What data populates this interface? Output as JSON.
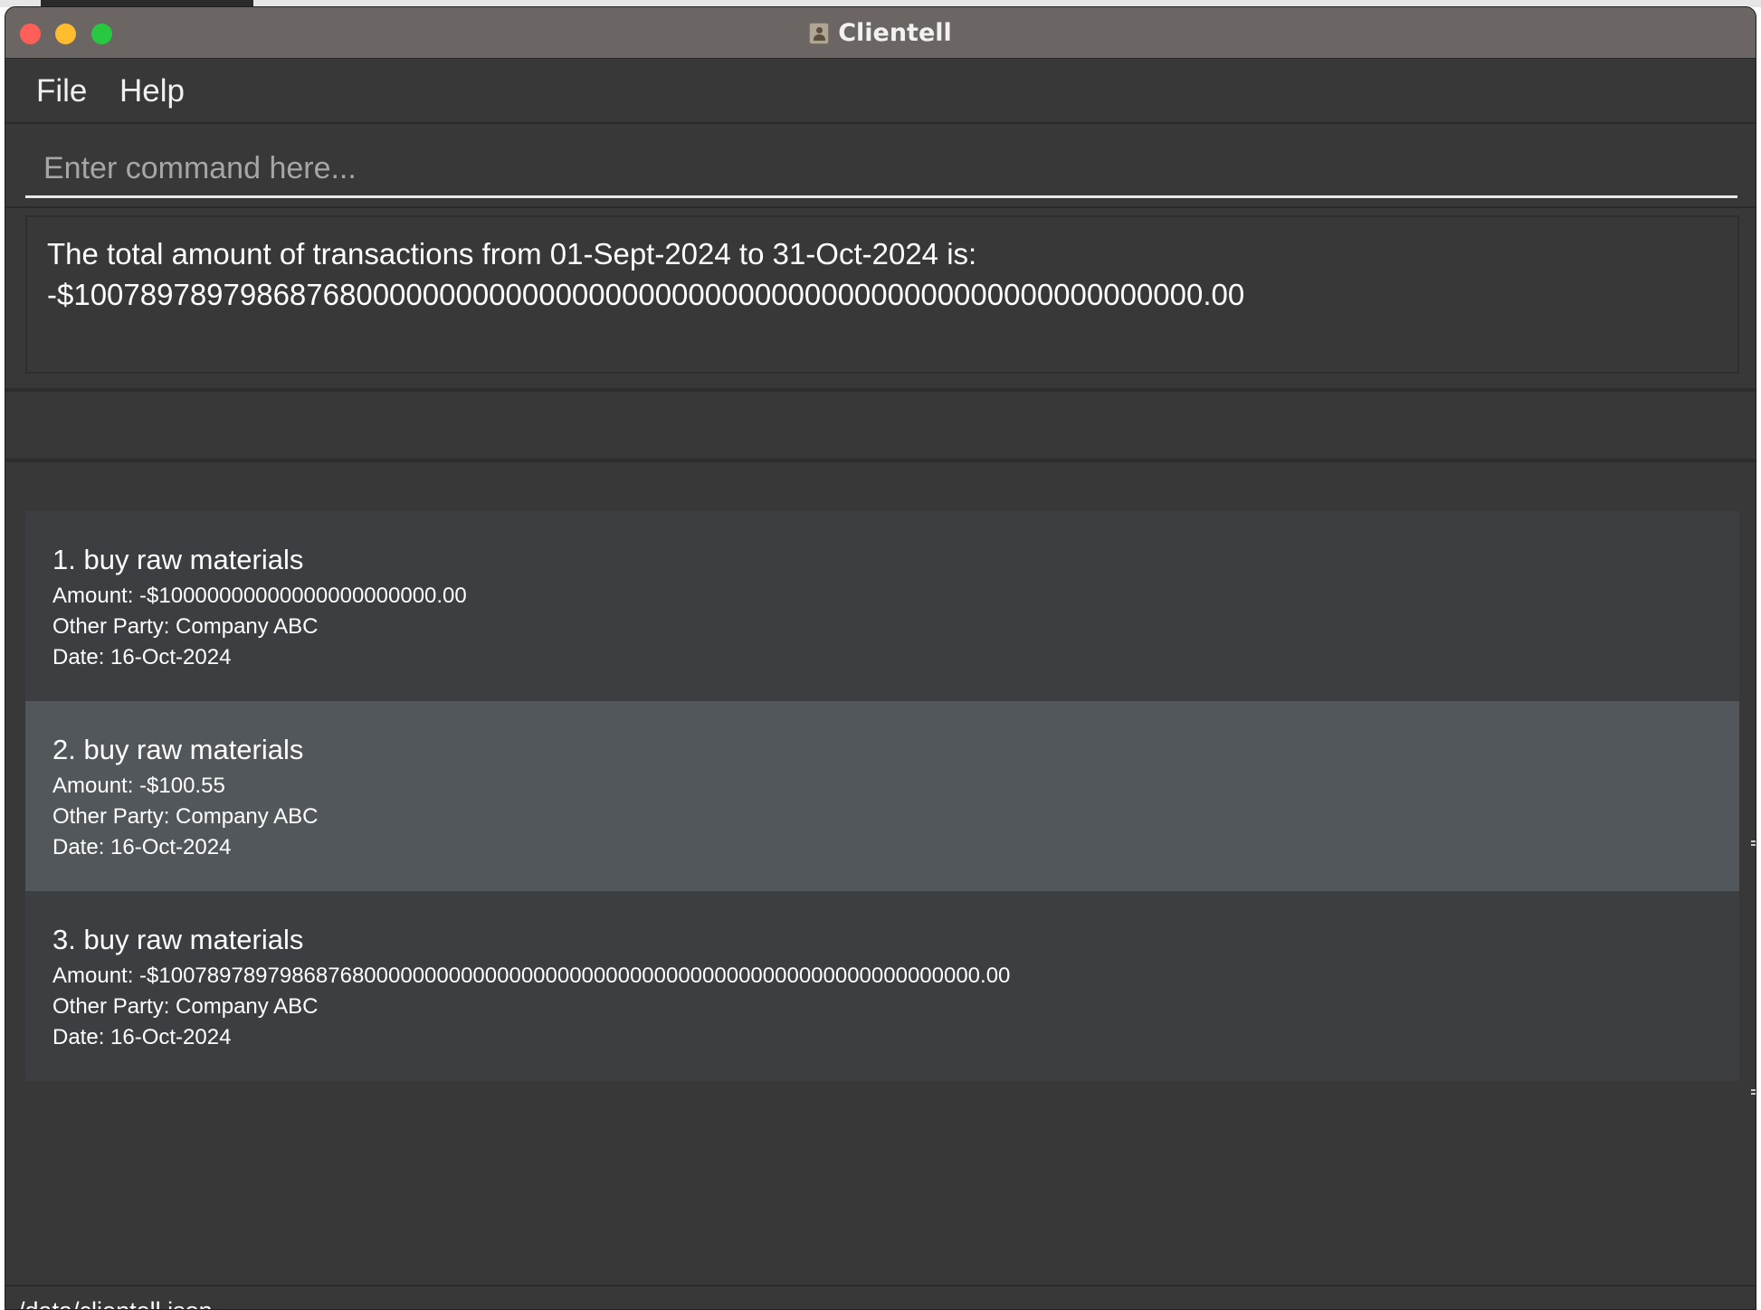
{
  "window": {
    "title": "Clientell"
  },
  "menu": {
    "file": "File",
    "help": "Help"
  },
  "command": {
    "placeholder": "Enter command here...",
    "value": ""
  },
  "result": {
    "text": "The total amount of transactions from 01-Sept-2024 to 31-Oct-2024 is:\n-$10078978979868768000000000000000000000000000000000000000000000000000.00"
  },
  "transactions": [
    {
      "title": "1. buy raw materials",
      "amount": "Amount: -$10000000000000000000000.00",
      "other_party": "Other Party: Company ABC",
      "date": "Date: 16-Oct-2024"
    },
    {
      "title": "2. buy raw materials",
      "amount": "Amount: -$100.55",
      "other_party": "Other Party: Company ABC",
      "date": "Date: 16-Oct-2024"
    },
    {
      "title": "3. buy raw materials",
      "amount": "Amount: -$10078978979868768000000000000000000000000000000000000000000000000000.00",
      "other_party": "Other Party: Company ABC",
      "date": "Date: 16-Oct-2024"
    }
  ],
  "status": {
    "path": "/data/clientell.json"
  },
  "icons": {
    "app": "address-book-icon"
  },
  "colors": {
    "titlebar": "#6b6563",
    "background": "#383838",
    "selected_row": "#52575b",
    "close": "#ff5f57",
    "minimize": "#febc2e",
    "zoom": "#28c840"
  }
}
